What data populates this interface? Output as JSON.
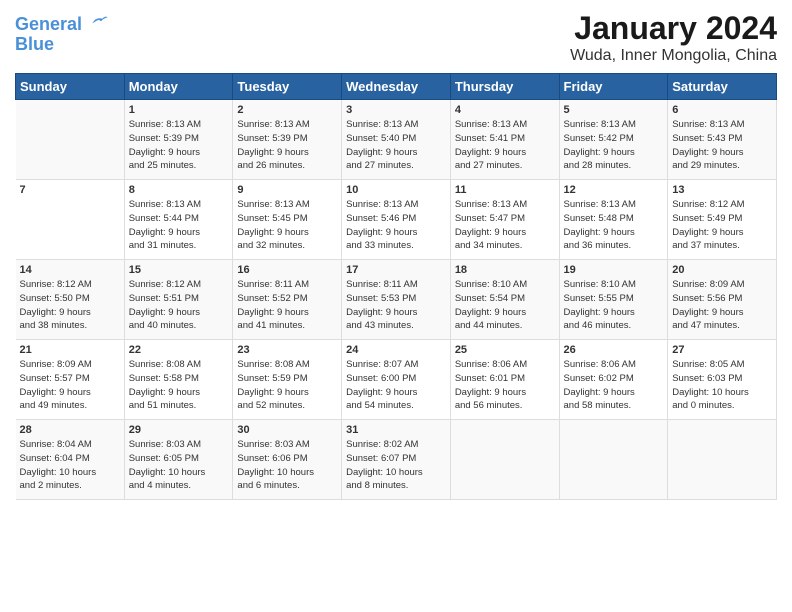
{
  "header": {
    "logo_line1": "General",
    "logo_line2": "Blue",
    "title": "January 2024",
    "subtitle": "Wuda, Inner Mongolia, China"
  },
  "calendar": {
    "days_of_week": [
      "Sunday",
      "Monday",
      "Tuesday",
      "Wednesday",
      "Thursday",
      "Friday",
      "Saturday"
    ],
    "weeks": [
      [
        {
          "day": "",
          "info": ""
        },
        {
          "day": "1",
          "info": "Sunrise: 8:13 AM\nSunset: 5:39 PM\nDaylight: 9 hours\nand 25 minutes."
        },
        {
          "day": "2",
          "info": "Sunrise: 8:13 AM\nSunset: 5:39 PM\nDaylight: 9 hours\nand 26 minutes."
        },
        {
          "day": "3",
          "info": "Sunrise: 8:13 AM\nSunset: 5:40 PM\nDaylight: 9 hours\nand 27 minutes."
        },
        {
          "day": "4",
          "info": "Sunrise: 8:13 AM\nSunset: 5:41 PM\nDaylight: 9 hours\nand 27 minutes."
        },
        {
          "day": "5",
          "info": "Sunrise: 8:13 AM\nSunset: 5:42 PM\nDaylight: 9 hours\nand 28 minutes."
        },
        {
          "day": "6",
          "info": "Sunrise: 8:13 AM\nSunset: 5:43 PM\nDaylight: 9 hours\nand 29 minutes."
        }
      ],
      [
        {
          "day": "7",
          "info": ""
        },
        {
          "day": "8",
          "info": "Sunrise: 8:13 AM\nSunset: 5:44 PM\nDaylight: 9 hours\nand 31 minutes."
        },
        {
          "day": "9",
          "info": "Sunrise: 8:13 AM\nSunset: 5:45 PM\nDaylight: 9 hours\nand 32 minutes."
        },
        {
          "day": "10",
          "info": "Sunrise: 8:13 AM\nSunset: 5:46 PM\nDaylight: 9 hours\nand 33 minutes."
        },
        {
          "day": "11",
          "info": "Sunrise: 8:13 AM\nSunset: 5:47 PM\nDaylight: 9 hours\nand 34 minutes."
        },
        {
          "day": "12",
          "info": "Sunrise: 8:13 AM\nSunset: 5:48 PM\nDaylight: 9 hours\nand 36 minutes."
        },
        {
          "day": "13",
          "info": "Sunrise: 8:12 AM\nSunset: 5:49 PM\nDaylight: 9 hours\nand 37 minutes."
        }
      ],
      [
        {
          "day": "14",
          "info": "Sunrise: 8:12 AM\nSunset: 5:50 PM\nDaylight: 9 hours\nand 38 minutes."
        },
        {
          "day": "15",
          "info": "Sunrise: 8:12 AM\nSunset: 5:51 PM\nDaylight: 9 hours\nand 40 minutes."
        },
        {
          "day": "16",
          "info": "Sunrise: 8:11 AM\nSunset: 5:52 PM\nDaylight: 9 hours\nand 41 minutes."
        },
        {
          "day": "17",
          "info": "Sunrise: 8:11 AM\nSunset: 5:53 PM\nDaylight: 9 hours\nand 43 minutes."
        },
        {
          "day": "18",
          "info": "Sunrise: 8:10 AM\nSunset: 5:54 PM\nDaylight: 9 hours\nand 44 minutes."
        },
        {
          "day": "19",
          "info": "Sunrise: 8:10 AM\nSunset: 5:55 PM\nDaylight: 9 hours\nand 46 minutes."
        },
        {
          "day": "20",
          "info": "Sunrise: 8:09 AM\nSunset: 5:56 PM\nDaylight: 9 hours\nand 47 minutes."
        }
      ],
      [
        {
          "day": "21",
          "info": "Sunrise: 8:09 AM\nSunset: 5:57 PM\nDaylight: 9 hours\nand 49 minutes."
        },
        {
          "day": "22",
          "info": "Sunrise: 8:08 AM\nSunset: 5:58 PM\nDaylight: 9 hours\nand 51 minutes."
        },
        {
          "day": "23",
          "info": "Sunrise: 8:08 AM\nSunset: 5:59 PM\nDaylight: 9 hours\nand 52 minutes."
        },
        {
          "day": "24",
          "info": "Sunrise: 8:07 AM\nSunset: 6:00 PM\nDaylight: 9 hours\nand 54 minutes."
        },
        {
          "day": "25",
          "info": "Sunrise: 8:06 AM\nSunset: 6:01 PM\nDaylight: 9 hours\nand 56 minutes."
        },
        {
          "day": "26",
          "info": "Sunrise: 8:06 AM\nSunset: 6:02 PM\nDaylight: 9 hours\nand 58 minutes."
        },
        {
          "day": "27",
          "info": "Sunrise: 8:05 AM\nSunset: 6:03 PM\nDaylight: 10 hours\nand 0 minutes."
        }
      ],
      [
        {
          "day": "28",
          "info": "Sunrise: 8:04 AM\nSunset: 6:04 PM\nDaylight: 10 hours\nand 2 minutes."
        },
        {
          "day": "29",
          "info": "Sunrise: 8:03 AM\nSunset: 6:05 PM\nDaylight: 10 hours\nand 4 minutes."
        },
        {
          "day": "30",
          "info": "Sunrise: 8:03 AM\nSunset: 6:06 PM\nDaylight: 10 hours\nand 6 minutes."
        },
        {
          "day": "31",
          "info": "Sunrise: 8:02 AM\nSunset: 6:07 PM\nDaylight: 10 hours\nand 8 minutes."
        },
        {
          "day": "",
          "info": ""
        },
        {
          "day": "",
          "info": ""
        },
        {
          "day": "",
          "info": ""
        }
      ]
    ]
  }
}
